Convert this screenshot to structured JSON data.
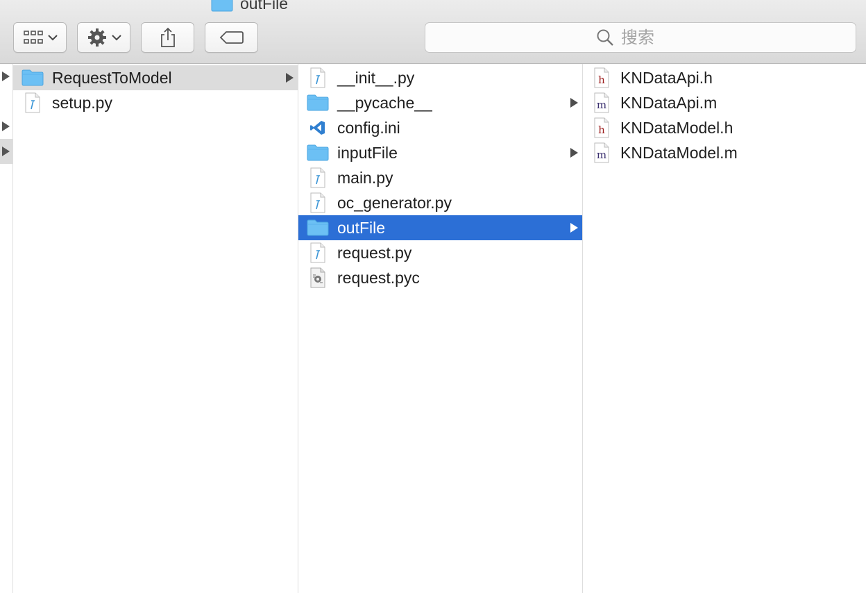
{
  "window": {
    "title": "outFile"
  },
  "toolbar": {
    "view_button": "view-options",
    "action_button": "action-menu",
    "share_button": "share",
    "tag_button": "tags"
  },
  "search": {
    "placeholder": "搜索"
  },
  "columns": [
    {
      "items": [
        {
          "label": "RequestToModel",
          "icon": "folder-icon",
          "folder": true
        },
        {
          "label": "setup.py",
          "icon": "python-file-icon",
          "folder": false
        }
      ]
    },
    {
      "items": [
        {
          "label": "__init__.py",
          "icon": "python-file-icon",
          "folder": false
        },
        {
          "label": "__pycache__",
          "icon": "folder-icon",
          "folder": true
        },
        {
          "label": "config.ini",
          "icon": "vscode-file-icon",
          "folder": false
        },
        {
          "label": "inputFile",
          "icon": "folder-icon",
          "folder": true
        },
        {
          "label": "main.py",
          "icon": "python-file-icon",
          "folder": false
        },
        {
          "label": "oc_generator.py",
          "icon": "python-file-icon",
          "folder": false
        },
        {
          "label": "outFile",
          "icon": "folder-icon",
          "folder": true
        },
        {
          "label": "request.py",
          "icon": "python-file-icon",
          "folder": false
        },
        {
          "label": "request.pyc",
          "icon": "compiled-file-icon",
          "folder": false
        }
      ]
    },
    {
      "items": [
        {
          "label": "KNDataApi.h",
          "icon": "header-file-icon",
          "folder": false
        },
        {
          "label": "KNDataApi.m",
          "icon": "objc-file-icon",
          "folder": false
        },
        {
          "label": "KNDataModel.h",
          "icon": "header-file-icon",
          "folder": false
        },
        {
          "label": "KNDataModel.m",
          "icon": "objc-file-icon",
          "folder": false
        }
      ]
    }
  ],
  "colors": {
    "selection_blue": "#2c6fd6",
    "selection_gray": "#dcdcdc",
    "folder_blue": "#6cc0f4"
  }
}
